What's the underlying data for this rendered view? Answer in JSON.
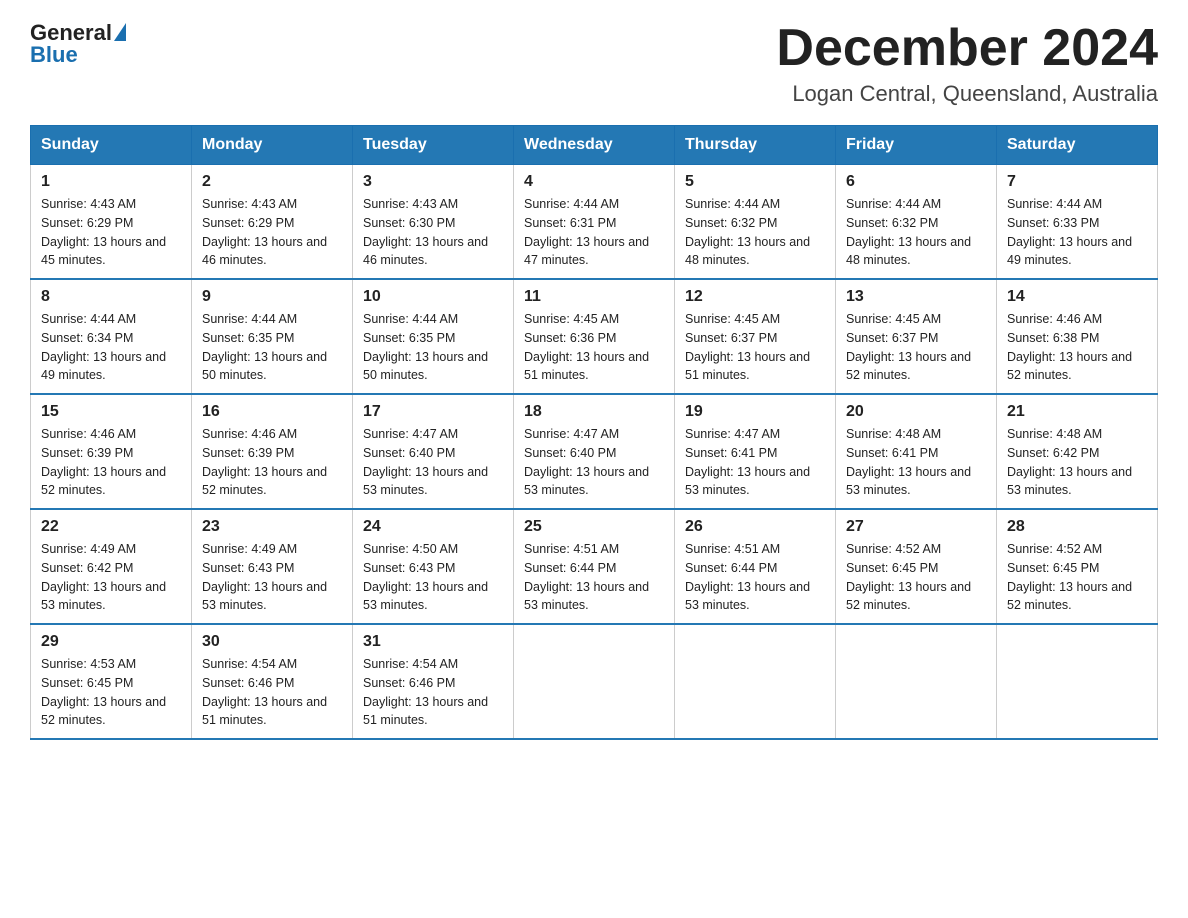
{
  "header": {
    "logo_general": "General",
    "logo_blue": "Blue",
    "title": "December 2024",
    "subtitle": "Logan Central, Queensland, Australia"
  },
  "days_of_week": [
    "Sunday",
    "Monday",
    "Tuesday",
    "Wednesday",
    "Thursday",
    "Friday",
    "Saturday"
  ],
  "weeks": [
    [
      {
        "day": "1",
        "sunrise": "4:43 AM",
        "sunset": "6:29 PM",
        "daylight": "13 hours and 45 minutes."
      },
      {
        "day": "2",
        "sunrise": "4:43 AM",
        "sunset": "6:29 PM",
        "daylight": "13 hours and 46 minutes."
      },
      {
        "day": "3",
        "sunrise": "4:43 AM",
        "sunset": "6:30 PM",
        "daylight": "13 hours and 46 minutes."
      },
      {
        "day": "4",
        "sunrise": "4:44 AM",
        "sunset": "6:31 PM",
        "daylight": "13 hours and 47 minutes."
      },
      {
        "day": "5",
        "sunrise": "4:44 AM",
        "sunset": "6:32 PM",
        "daylight": "13 hours and 48 minutes."
      },
      {
        "day": "6",
        "sunrise": "4:44 AM",
        "sunset": "6:32 PM",
        "daylight": "13 hours and 48 minutes."
      },
      {
        "day": "7",
        "sunrise": "4:44 AM",
        "sunset": "6:33 PM",
        "daylight": "13 hours and 49 minutes."
      }
    ],
    [
      {
        "day": "8",
        "sunrise": "4:44 AM",
        "sunset": "6:34 PM",
        "daylight": "13 hours and 49 minutes."
      },
      {
        "day": "9",
        "sunrise": "4:44 AM",
        "sunset": "6:35 PM",
        "daylight": "13 hours and 50 minutes."
      },
      {
        "day": "10",
        "sunrise": "4:44 AM",
        "sunset": "6:35 PM",
        "daylight": "13 hours and 50 minutes."
      },
      {
        "day": "11",
        "sunrise": "4:45 AM",
        "sunset": "6:36 PM",
        "daylight": "13 hours and 51 minutes."
      },
      {
        "day": "12",
        "sunrise": "4:45 AM",
        "sunset": "6:37 PM",
        "daylight": "13 hours and 51 minutes."
      },
      {
        "day": "13",
        "sunrise": "4:45 AM",
        "sunset": "6:37 PM",
        "daylight": "13 hours and 52 minutes."
      },
      {
        "day": "14",
        "sunrise": "4:46 AM",
        "sunset": "6:38 PM",
        "daylight": "13 hours and 52 minutes."
      }
    ],
    [
      {
        "day": "15",
        "sunrise": "4:46 AM",
        "sunset": "6:39 PM",
        "daylight": "13 hours and 52 minutes."
      },
      {
        "day": "16",
        "sunrise": "4:46 AM",
        "sunset": "6:39 PM",
        "daylight": "13 hours and 52 minutes."
      },
      {
        "day": "17",
        "sunrise": "4:47 AM",
        "sunset": "6:40 PM",
        "daylight": "13 hours and 53 minutes."
      },
      {
        "day": "18",
        "sunrise": "4:47 AM",
        "sunset": "6:40 PM",
        "daylight": "13 hours and 53 minutes."
      },
      {
        "day": "19",
        "sunrise": "4:47 AM",
        "sunset": "6:41 PM",
        "daylight": "13 hours and 53 minutes."
      },
      {
        "day": "20",
        "sunrise": "4:48 AM",
        "sunset": "6:41 PM",
        "daylight": "13 hours and 53 minutes."
      },
      {
        "day": "21",
        "sunrise": "4:48 AM",
        "sunset": "6:42 PM",
        "daylight": "13 hours and 53 minutes."
      }
    ],
    [
      {
        "day": "22",
        "sunrise": "4:49 AM",
        "sunset": "6:42 PM",
        "daylight": "13 hours and 53 minutes."
      },
      {
        "day": "23",
        "sunrise": "4:49 AM",
        "sunset": "6:43 PM",
        "daylight": "13 hours and 53 minutes."
      },
      {
        "day": "24",
        "sunrise": "4:50 AM",
        "sunset": "6:43 PM",
        "daylight": "13 hours and 53 minutes."
      },
      {
        "day": "25",
        "sunrise": "4:51 AM",
        "sunset": "6:44 PM",
        "daylight": "13 hours and 53 minutes."
      },
      {
        "day": "26",
        "sunrise": "4:51 AM",
        "sunset": "6:44 PM",
        "daylight": "13 hours and 53 minutes."
      },
      {
        "day": "27",
        "sunrise": "4:52 AM",
        "sunset": "6:45 PM",
        "daylight": "13 hours and 52 minutes."
      },
      {
        "day": "28",
        "sunrise": "4:52 AM",
        "sunset": "6:45 PM",
        "daylight": "13 hours and 52 minutes."
      }
    ],
    [
      {
        "day": "29",
        "sunrise": "4:53 AM",
        "sunset": "6:45 PM",
        "daylight": "13 hours and 52 minutes."
      },
      {
        "day": "30",
        "sunrise": "4:54 AM",
        "sunset": "6:46 PM",
        "daylight": "13 hours and 51 minutes."
      },
      {
        "day": "31",
        "sunrise": "4:54 AM",
        "sunset": "6:46 PM",
        "daylight": "13 hours and 51 minutes."
      },
      null,
      null,
      null,
      null
    ]
  ]
}
